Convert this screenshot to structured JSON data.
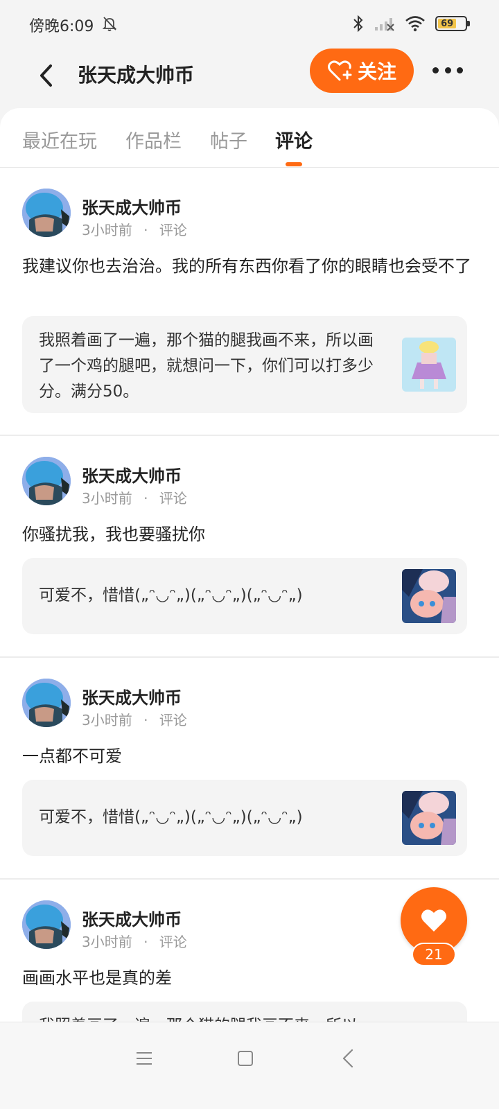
{
  "status_bar": {
    "time": "傍晚6:09",
    "battery_level": "69",
    "icons": [
      "bell-off-icon",
      "bluetooth-icon",
      "signal-icon",
      "wifi-icon",
      "battery-icon"
    ]
  },
  "header": {
    "title": "张天成大帅币",
    "follow_label": "关注",
    "accent_color": "#ff6a13"
  },
  "tabs": [
    {
      "label": "最近在玩",
      "active": false
    },
    {
      "label": "作品栏",
      "active": false
    },
    {
      "label": "帖子",
      "active": false
    },
    {
      "label": "评论",
      "active": true
    }
  ],
  "posts": [
    {
      "author": "张天成大帅币",
      "time": "3小时前",
      "type": "评论",
      "text": "我建议你也去治治。我的所有东西你看了你的眼睛也会受不了",
      "quote": "我照着画了一遍，那个猫的腿我画不来，所以画了一个鸡的腿吧，就想问一下，你们可以打多少分。满分50。"
    },
    {
      "author": "张天成大帅币",
      "time": "3小时前",
      "type": "评论",
      "text": "你骚扰我，我也要骚扰你",
      "quote": "可爱不，惜惜(„ᵔ◡ᵔ„)(„ᵔ◡ᵔ„)(„ᵔ◡ᵔ„)"
    },
    {
      "author": "张天成大帅币",
      "time": "3小时前",
      "type": "评论",
      "text": "一点都不可爱",
      "quote": "可爱不，惜惜(„ᵔ◡ᵔ„)(„ᵔ◡ᵔ„)(„ᵔ◡ᵔ„)"
    },
    {
      "author": "张天成大帅币",
      "time": "3小时前",
      "type": "评论",
      "text": "画画水平也是真的差",
      "quote": "我照着画了一遍，那个猫的腿我画不来，所以"
    }
  ],
  "like_fab": {
    "count": "21"
  },
  "meta_separator": "·"
}
